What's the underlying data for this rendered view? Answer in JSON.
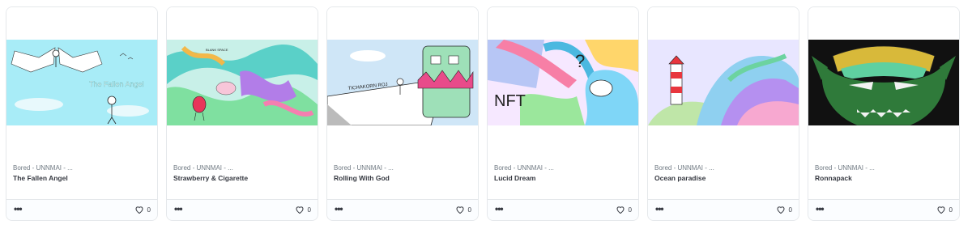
{
  "cards": [
    {
      "collection": "Bored - UNNMAI - ...",
      "title": "The Fallen Angel",
      "likes": "0",
      "image_text": "The Fallen Angel"
    },
    {
      "collection": "Bored - UNNMAI - ...",
      "title": "Strawberry & Cigarette",
      "likes": "0",
      "image_text": "BLANK SPACE"
    },
    {
      "collection": "Bored - UNNMAI - ...",
      "title": "Rolling With God",
      "likes": "0",
      "image_text": "TICHAKORN ROJ"
    },
    {
      "collection": "Bored - UNNMAI - ...",
      "title": "Lucid Dream",
      "likes": "0",
      "image_text": "NFT"
    },
    {
      "collection": "Bored - UNNMAI - ...",
      "title": "Ocean paradise",
      "likes": "0",
      "image_text": ""
    },
    {
      "collection": "Bored - UNNMAI - ...",
      "title": "Ronnapack",
      "likes": "0",
      "image_text": ""
    }
  ],
  "more_label": "•••",
  "colors": {
    "border": "#e5e8eb",
    "text": "#353840",
    "muted": "#707a83"
  }
}
